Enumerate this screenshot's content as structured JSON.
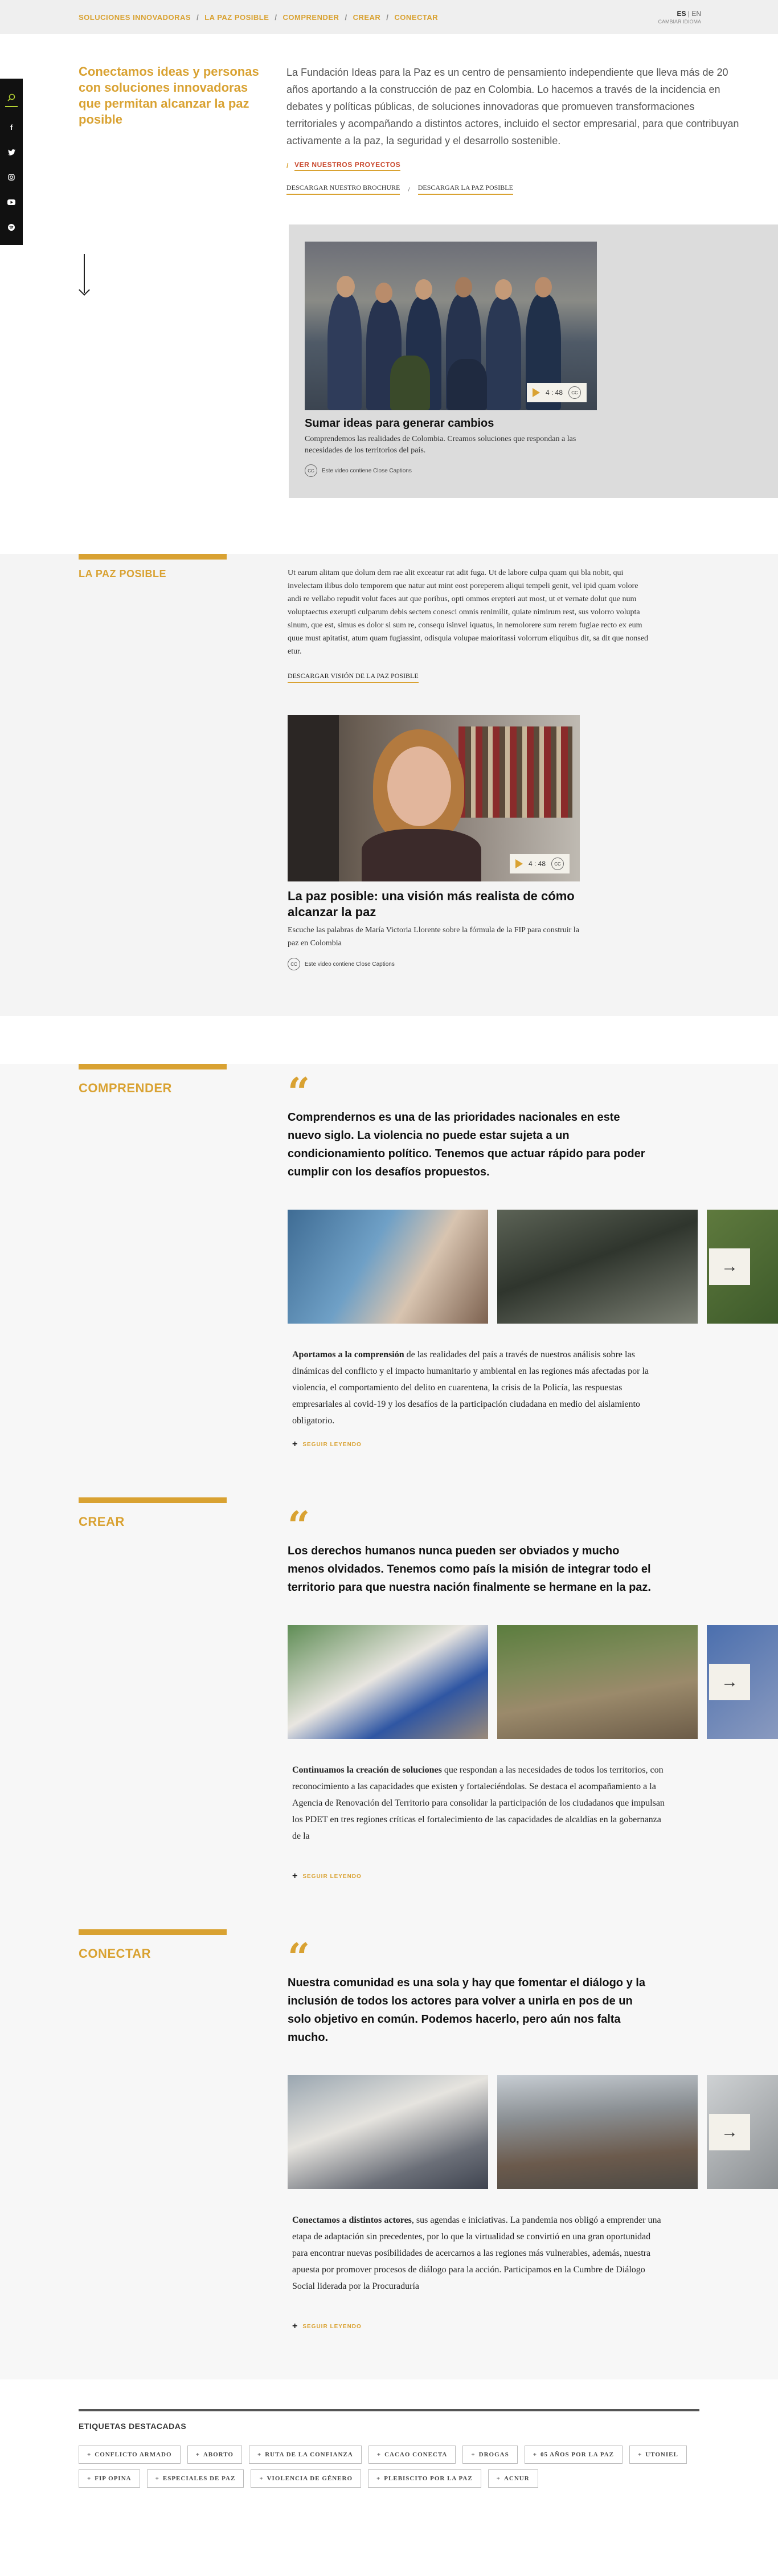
{
  "breadcrumb": [
    "SOLUCIONES INNOVADORAS",
    "LA PAZ POSIBLE",
    "COMPRENDER",
    "CREAR",
    "CONECTAR"
  ],
  "lang": {
    "es": "ES",
    "sep": " | ",
    "en": "EN",
    "sub": "CAMBIAR IDIOMA"
  },
  "intro": {
    "title": "Conectamos ideas y personas con soluciones innovadoras que permitan alcanzar la paz posible",
    "lead": "La Fundación Ideas para la Paz es un centro de pensamiento independiente que lleva más de 20 años aportando a la construcción de paz en Colombia. Lo hacemos a través de la incidencia en debates y políticas públicas, de soluciones innovadoras que promueven transformaciones territoriales y acompañando a distintos actores, incluido el sector empresarial, para que contribuyan activamente a la paz, la seguridad y el desarrollo sostenible.",
    "projects_link": "VER NUESTROS PROYECTOS",
    "download_brochure": "DESCARGAR NUESTRO BROCHURE",
    "download_paz": "DESCARGAR LA PAZ POSIBLE"
  },
  "video1": {
    "title": "Sumar ideas para generar cambios",
    "desc": "Comprendemos las realidades de Colombia. Creamos soluciones que respondan a las necesidades de los territorios del país.",
    "duration": "4 : 48",
    "cc_label": "CC",
    "cc_note": "Este video contiene Close Captions"
  },
  "paz": {
    "label": "LA PAZ POSIBLE",
    "text": "Ut earum alitam que dolum dem rae alit exceatur rat adit fuga. Ut de labore culpa quam qui bla nobit, qui invelectam ilibus dolo temporem que natur aut mint eost poreperem aliqui tempeli genit, vel ipid quam volore andi re vellabo repudit volut faces aut que poribus, opti ommos erepteri aut most, ut et vernate dolut que num voluptaectus exerupti culparum debis sectem conesci omnis renimilit, quiate nimirum rest, sus volorro volupta sinum, que est, simus es dolor si sum re, consequ isinvel iquatus, in nemolorere sum rerem fugiae recto ex eum quue must apitatist, atum quam fugiassint, odisquia volupae maioritassi volorrum eliquibus dit, sa dit que nonsed etur.",
    "download": "DESCARGAR VISIÓN DE LA PAZ POSIBLE",
    "video": {
      "title": "La paz posible: una visión más realista de cómo alcanzar la paz",
      "desc": "Escuche las palabras de María Victoria Llorente sobre la fórmula de la FIP para construir la paz en Colombia",
      "duration": "4 : 48",
      "cc_label": "CC",
      "cc_note": "Este video contiene Close Captions"
    }
  },
  "comprender": {
    "label": "COMPRENDER",
    "quote": "Comprendernos es una de las prioridades nacionales en este nuevo siglo. La violencia no puede estar sujeta a un condicionamiento político. Tenemos que actuar rápido para poder cumplir con los desafíos propuestos.",
    "lead_bold": "Aportamos a la comprensión",
    "text": " de las realidades del país a través de nuestros análisis sobre las dinámicas del conflicto y el impacto humanitario y ambiental en las regiones más afectadas por la violencia, el comportamiento del delito en cuarentena, la crisis de la Policía, las respuestas empresariales al covid-19 y los desafíos de la participación ciudadana en medio del aislamiento obligatorio.",
    "more": "SEGUIR LEYENDO"
  },
  "crear": {
    "label": "CREAR",
    "quote": "Los derechos humanos nunca pueden ser obviados y mucho menos olvidados. Tenemos como país la misión de integrar todo el territorio para que nuestra nación finalmente se hermane en la paz.",
    "lead_bold": "Continuamos la creación de soluciones",
    "text": " que respondan a las necesidades de todos los territorios, con reconocimiento a las capacidades que existen y fortaleciéndolas. Se destaca el acompañamiento a la Agencia de Renovación del Territorio para consolidar la participación de los ciudadanos que impulsan los PDET en tres regiones críticas el fortalecimiento de las capacidades de alcaldías en la gobernanza de la",
    "more": "SEGUIR LEYENDO"
  },
  "conectar": {
    "label": "CONECTAR",
    "quote": "Nuestra comunidad es una sola y hay que fomentar el diálogo y la inclusión de todos los actores para volver a unirla en pos de un solo objetivo en común. Podemos hacerlo, pero aún nos falta mucho.",
    "lead_bold": "Conectamos a distintos actores",
    "text": ", sus agendas e iniciativas. La pandemia nos obligó a emprender una etapa de adaptación sin precedentes, por lo que la virtualidad se convirtió en una gran oportunidad para encontrar nuevas posibilidades de acercarnos a las regiones más vulnerables, además, nuestra apuesta por promover procesos de diálogo para la acción. Participamos en la Cumbre de Diálogo Social liderada por la Procuraduría",
    "more": "SEGUIR LEYENDO"
  },
  "tags": {
    "title": "ETIQUETAS DESTACADAS",
    "items": [
      "CONFLICTO ARMADO",
      "ABORTO",
      "RUTA DE LA CONFIANZA",
      "CACAO CONECTA",
      "DROGAS",
      "05 AÑOS POR LA PAZ",
      "UTONIEL",
      "FIP OPINA",
      "ESPECIALES DE PAZ",
      "VIOLENCIA DE GÉNERO",
      "PLEBISCITO POR LA PAZ",
      "ACNUR"
    ]
  }
}
